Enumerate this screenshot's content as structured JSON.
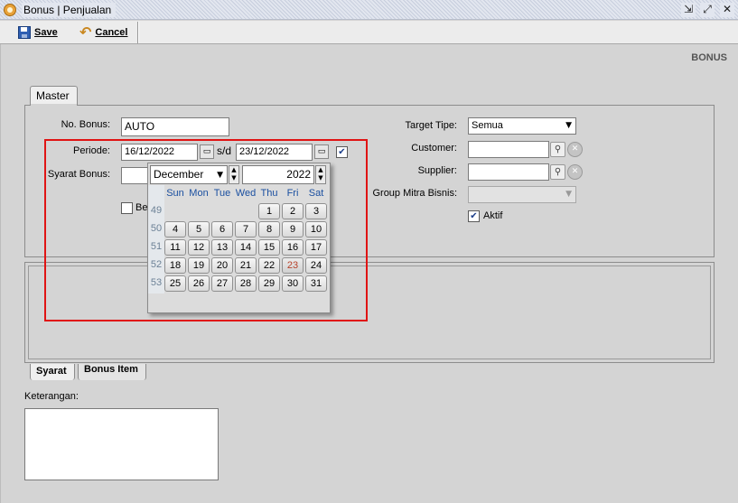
{
  "window": {
    "title": "Bonus | Penjualan"
  },
  "toolbar": {
    "save_label": "Save",
    "cancel_label": "Cancel"
  },
  "section_label": "BONUS",
  "tabs": {
    "master": "Master",
    "syarat": "Syarat",
    "bonus_item": "Bonus Item"
  },
  "form": {
    "no_bonus_label": "No. Bonus:",
    "no_bonus_value": "AUTO",
    "periode_label": "Periode:",
    "periode_from": "16/12/2022",
    "periode_sep": "s/d",
    "periode_to": "23/12/2022",
    "syarat_bonus_label": "Syarat Bonus:",
    "syarat_bonus_value": "",
    "be_label": "Be",
    "target_tipe_label": "Target Tipe:",
    "target_tipe_value": "Semua",
    "customer_label": "Customer:",
    "customer_value": "",
    "supplier_label": "Supplier:",
    "supplier_value": "",
    "group_mitra_label": "Group Mitra Bisnis:",
    "group_mitra_value": "",
    "aktif_label": "Aktif",
    "aktif_checked": true,
    "periode_checked": true
  },
  "calendar": {
    "month": "December",
    "year": "2022",
    "weekdays": [
      "Sun",
      "Mon",
      "Tue",
      "Wed",
      "Thu",
      "Fri",
      "Sat"
    ],
    "weeks": [
      {
        "week": "49",
        "days": [
          "",
          "",
          "",
          "",
          "1",
          "2",
          "3"
        ]
      },
      {
        "week": "50",
        "days": [
          "4",
          "5",
          "6",
          "7",
          "8",
          "9",
          "10"
        ]
      },
      {
        "week": "51",
        "days": [
          "11",
          "12",
          "13",
          "14",
          "15",
          "16",
          "17"
        ]
      },
      {
        "week": "52",
        "days": [
          "18",
          "19",
          "20",
          "21",
          "22",
          "23",
          "24"
        ]
      },
      {
        "week": "53",
        "days": [
          "25",
          "26",
          "27",
          "28",
          "29",
          "30",
          "31"
        ]
      }
    ],
    "today": "23"
  },
  "keterangan": {
    "label": "Keterangan:",
    "value": ""
  },
  "icons": {
    "app": "bonus-app-icon",
    "save": "floppy-disk-icon",
    "cancel": "undo-arrow-icon",
    "calendar": "calendar-icon",
    "search": "magnifier-icon",
    "clear": "clear-circle-icon"
  },
  "colors": {
    "highlight": "#e01414",
    "today": "#b7422a",
    "weekday_header": "#1a4fa0"
  }
}
